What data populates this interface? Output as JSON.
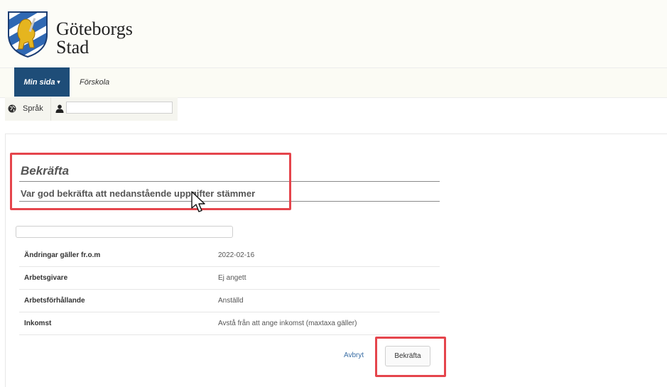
{
  "header": {
    "logo_line1": "Göteborgs",
    "logo_line2": "Stad",
    "logo_icon": "city-shield-lion-icon"
  },
  "nav": {
    "tabs": [
      {
        "label": "Min sida",
        "active": true,
        "has_dropdown": true
      },
      {
        "label": "Förskola",
        "active": false
      }
    ]
  },
  "toolbar": {
    "language_icon": "globe-icon",
    "language_label": "Språk",
    "user_icon": "user-icon",
    "user_input_value": ""
  },
  "form": {
    "title": "Bekräfta",
    "subtitle": "Var god bekräfta att nedanstående uppgifter stämmer",
    "search_value": "",
    "rows": [
      {
        "label": "Ändringar gäller fr.o.m",
        "value": "2022-02-16"
      },
      {
        "label": "Arbetsgivare",
        "value": "Ej angett"
      },
      {
        "label": "Arbetsförhållande",
        "value": "Anställd"
      },
      {
        "label": "Inkomst",
        "value": "Avstå från att ange inkomst (maxtaxa gäller)"
      }
    ],
    "cancel_label": "Avbryt",
    "confirm_label": "Bekräfta"
  },
  "colors": {
    "nav_active_bg": "#1e4d78",
    "highlight_red": "#e5454c",
    "link_blue": "#3a6ea5"
  }
}
